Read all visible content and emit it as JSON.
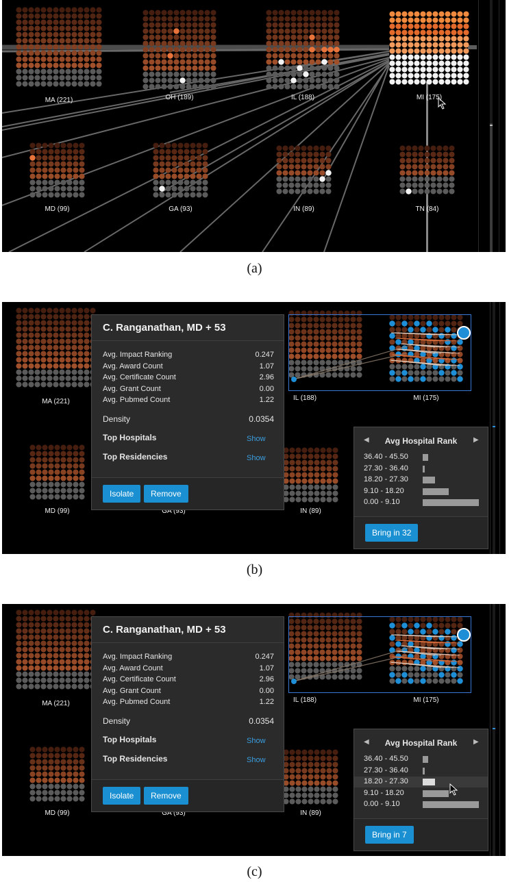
{
  "panels": [
    {
      "caption": "(a)",
      "clusters": [
        {
          "id": "ma",
          "label": "MA (221)"
        },
        {
          "id": "oh",
          "label": "OH (189)"
        },
        {
          "id": "il",
          "label": "IL (188)"
        },
        {
          "id": "mi",
          "label": "MI (175)"
        },
        {
          "id": "md",
          "label": "MD (99)"
        },
        {
          "id": "ga",
          "label": "GA (93)"
        },
        {
          "id": "in",
          "label": "IN (89)"
        },
        {
          "id": "tn",
          "label": "TN (84)"
        }
      ]
    },
    {
      "caption": "(b)",
      "clusters": [
        {
          "id": "ma",
          "label": "MA (221)"
        },
        {
          "id": "il",
          "label": "IL (188)"
        },
        {
          "id": "mi",
          "label": "MI (175)"
        },
        {
          "id": "md",
          "label": "MD (99)"
        },
        {
          "id": "ga",
          "label": "GA (93)"
        },
        {
          "id": "in",
          "label": "IN (89)"
        }
      ],
      "bring_label": "Bring in 32",
      "highlighted_row": -1
    },
    {
      "caption": "(c)",
      "clusters": [
        {
          "id": "ma",
          "label": "MA (221)"
        },
        {
          "id": "il",
          "label": "IL (188)"
        },
        {
          "id": "mi",
          "label": "MI (175)"
        },
        {
          "id": "md",
          "label": "MD (99)"
        },
        {
          "id": "ga",
          "label": "GA (93)"
        },
        {
          "id": "in",
          "label": "IN (89)"
        }
      ],
      "bring_label": "Bring in 7",
      "highlighted_row": 2
    }
  ],
  "details": {
    "title": "C. Ranganathan, MD + 53",
    "metrics": [
      {
        "label": "Avg. Impact Ranking",
        "value": "0.247"
      },
      {
        "label": "Avg. Award Count",
        "value": "1.07"
      },
      {
        "label": "Avg. Certificate Count",
        "value": "2.96"
      },
      {
        "label": "Avg. Grant Count",
        "value": "0.00"
      },
      {
        "label": "Avg. Pubmed Count",
        "value": "1.22"
      }
    ],
    "density_label": "Density",
    "density_value": "0.0354",
    "top_hospitals_label": "Top Hospitals",
    "top_residencies_label": "Top Residencies",
    "show_label": "Show",
    "isolate_label": "Isolate",
    "remove_label": "Remove"
  },
  "hospital_rank": {
    "title": "Avg Hospital Rank",
    "left_arrow": "◀",
    "right_arrow": "▶",
    "rows": [
      {
        "label": "36.40 - 45.50",
        "fraction": 0.1
      },
      {
        "label": "27.30 - 36.40",
        "fraction": 0.04
      },
      {
        "label": "18.20 - 27.30",
        "fraction": 0.22
      },
      {
        "label": "9.10 - 18.20",
        "fraction": 0.46
      },
      {
        "label": "0.00 - 9.10",
        "fraction": 1.0
      }
    ]
  },
  "colors": {
    "background": "#000000",
    "dot_grey": "#5b5b5b",
    "dot_white": "#f2f2f2",
    "dot_orange": "#e8743b",
    "dot_blue": "#1e8fd6",
    "button_blue": "#1a8fd1",
    "link_blue": "#3a9ee0"
  }
}
